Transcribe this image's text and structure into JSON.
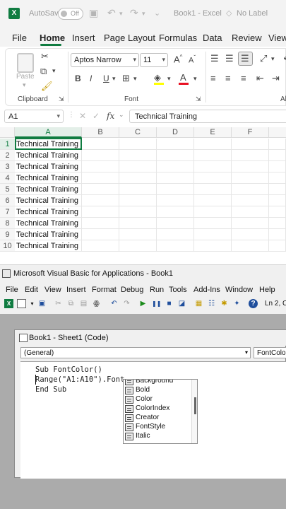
{
  "excel": {
    "autosave_label": "AutoSave",
    "autosave_state": "Off",
    "doc_title": "Book1 - Excel",
    "sensitivity": "No Label",
    "menu": [
      "File",
      "Home",
      "Insert",
      "Page Layout",
      "Formulas",
      "Data",
      "Review",
      "View"
    ],
    "active_menu": "Home",
    "ribbon": {
      "paste_label": "Paste",
      "clipboard_label": "Clipboard",
      "font_label": "Font",
      "alignment_label": "Ali",
      "font_name": "Aptos Narrow",
      "font_size": "11",
      "bold": "B",
      "italic": "I",
      "underline": "U",
      "grow": "A",
      "shrink": "A",
      "font_color_letter": "A",
      "accent_fill": "#ffff00",
      "accent_font": "#e81123"
    },
    "name_box": "A1",
    "formula_value": "Technical Training",
    "columns": [
      "A",
      "B",
      "C",
      "D",
      "E",
      "F"
    ],
    "rows": [
      {
        "num": "1",
        "a": "Technical Training"
      },
      {
        "num": "2",
        "a": "Technical Training"
      },
      {
        "num": "3",
        "a": "Technical Training"
      },
      {
        "num": "4",
        "a": "Technical Training"
      },
      {
        "num": "5",
        "a": "Technical Training"
      },
      {
        "num": "6",
        "a": "Technical Training"
      },
      {
        "num": "7",
        "a": "Technical Training"
      },
      {
        "num": "8",
        "a": "Technical Training"
      },
      {
        "num": "9",
        "a": "Technical Training"
      },
      {
        "num": "10",
        "a": "Technical Training"
      }
    ],
    "brand_color": "#107c41"
  },
  "vba": {
    "title": "Microsoft Visual Basic for Applications - Book1",
    "menu": [
      "File",
      "Edit",
      "View",
      "Insert",
      "Format",
      "Debug",
      "Run",
      "Tools",
      "Add-Ins",
      "Window",
      "Help"
    ],
    "position": "Ln 2, C",
    "code_window_title": "Book1 - Sheet1 (Code)",
    "object_combo": "(General)",
    "proc_combo": "FontColor",
    "code_lines": [
      "Sub FontColor()",
      "Range(\"A1:A10\").Font.",
      "End Sub"
    ],
    "autocomplete": [
      "Background",
      "Bold",
      "Color",
      "ColorIndex",
      "Creator",
      "FontStyle",
      "Italic"
    ]
  }
}
